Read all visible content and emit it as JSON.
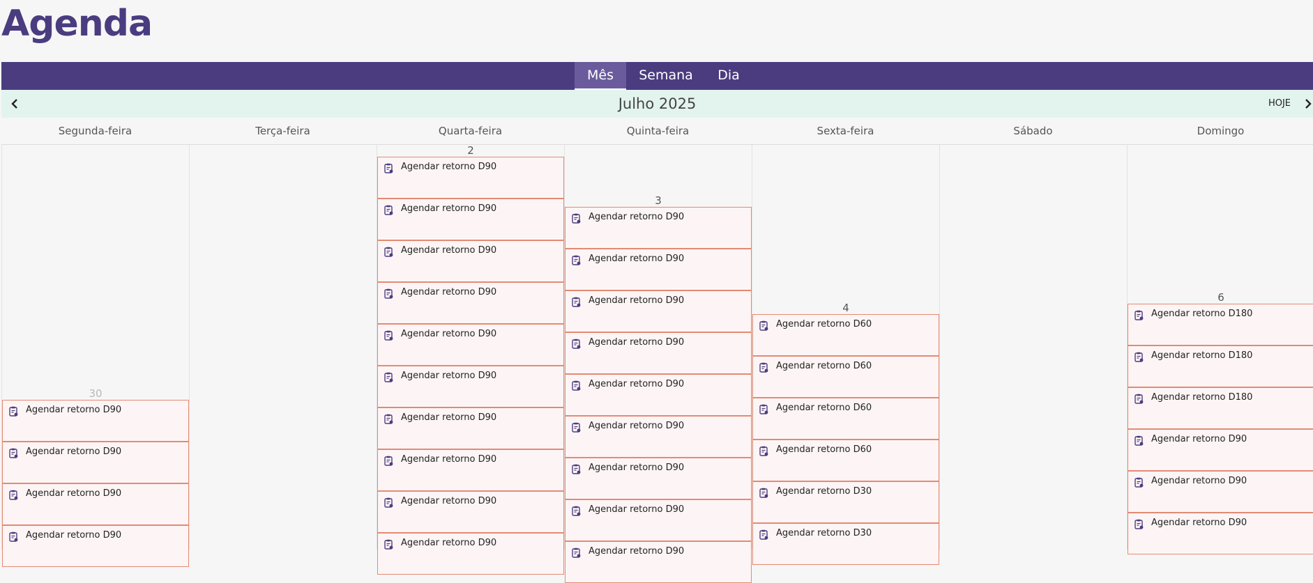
{
  "page": {
    "title": "Agenda"
  },
  "tabs": [
    {
      "label": "Mês",
      "active": true
    },
    {
      "label": "Semana",
      "active": false
    },
    {
      "label": "Dia",
      "active": false
    }
  ],
  "navigation": {
    "prev_icon": "chevron-left-icon",
    "next_icon": "chevron-right-icon",
    "month_label": "Julho 2025",
    "today_label": "HOJE"
  },
  "weekdays": [
    "Segunda-feira",
    "Terça-feira",
    "Quarta-feira",
    "Quinta-feira",
    "Sexta-feira",
    "Sábado",
    "Domingo"
  ],
  "colors": {
    "brand": "#4b3c80",
    "event_border": "#e38a73",
    "event_background": "#fdf5f5",
    "nav_background": "#e3f4ef"
  },
  "event_icon": "clipboard-user-icon",
  "days": [
    {
      "weekday": "Segunda-feira",
      "number": "30",
      "muted": true,
      "events": [
        "Agendar retorno D90",
        "Agendar retorno D90",
        "Agendar retorno D90",
        "Agendar retorno D90"
      ]
    },
    {
      "weekday": "Terça-feira",
      "number": "",
      "muted": false,
      "events": []
    },
    {
      "weekday": "Quarta-feira",
      "number": "2",
      "muted": false,
      "events": [
        "Agendar retorno D90",
        "Agendar retorno D90",
        "Agendar retorno D90",
        "Agendar retorno D90",
        "Agendar retorno D90",
        "Agendar retorno D90",
        "Agendar retorno D90",
        "Agendar retorno D90",
        "Agendar retorno D90",
        "Agendar retorno D90"
      ]
    },
    {
      "weekday": "Quinta-feira",
      "number": "3",
      "muted": false,
      "events": [
        "Agendar retorno D90",
        "Agendar retorno D90",
        "Agendar retorno D90",
        "Agendar retorno D90",
        "Agendar retorno D90",
        "Agendar retorno D90",
        "Agendar retorno D90",
        "Agendar retorno D90",
        "Agendar retorno D90"
      ]
    },
    {
      "weekday": "Sexta-feira",
      "number": "4",
      "muted": false,
      "events": [
        "Agendar retorno D60",
        "Agendar retorno D60",
        "Agendar retorno D60",
        "Agendar retorno D60",
        "Agendar retorno D30",
        "Agendar retorno D30"
      ]
    },
    {
      "weekday": "Sábado",
      "number": "",
      "muted": false,
      "events": []
    },
    {
      "weekday": "Domingo",
      "number": "6",
      "muted": false,
      "events": [
        "Agendar retorno D180",
        "Agendar retorno D180",
        "Agendar retorno D180",
        "Agendar retorno D90",
        "Agendar retorno D90",
        "Agendar retorno D90"
      ]
    }
  ]
}
